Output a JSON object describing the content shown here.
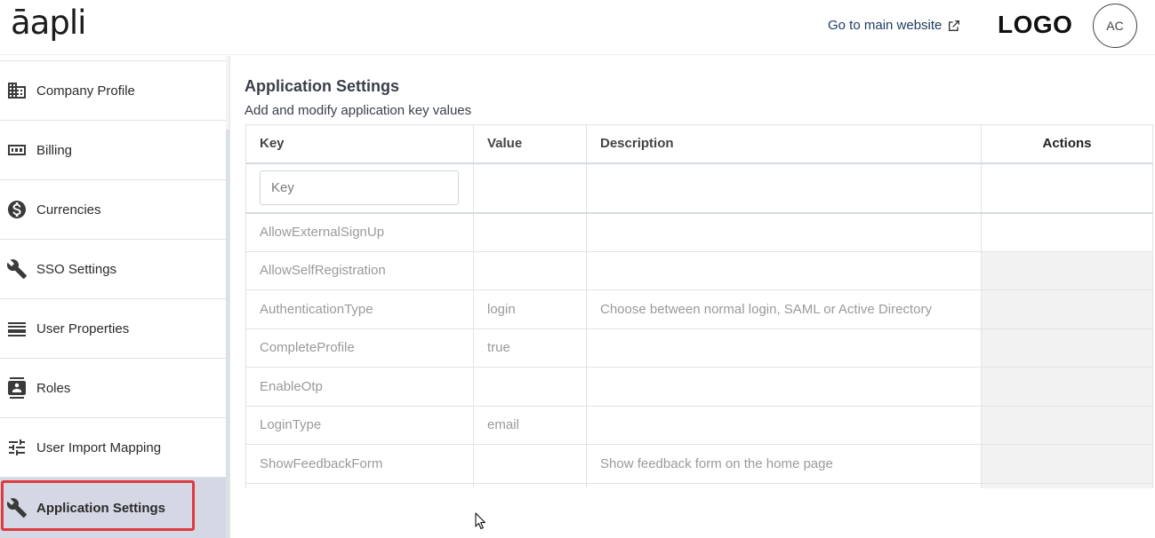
{
  "header": {
    "brand": "āapli",
    "main_link": "Go to main website",
    "logo": "LOGO",
    "avatar_initials": "AC"
  },
  "sidebar": {
    "items": [
      {
        "label": "Company Profile",
        "icon": "building-icon"
      },
      {
        "label": "Billing",
        "icon": "counter-icon"
      },
      {
        "label": "Currencies",
        "icon": "dollar-circle-icon"
      },
      {
        "label": "SSO Settings",
        "icon": "wrench-icon"
      },
      {
        "label": "User Properties",
        "icon": "list-icon"
      },
      {
        "label": "Roles",
        "icon": "contact-card-icon"
      },
      {
        "label": "User Import Mapping",
        "icon": "tune-sliders-icon"
      },
      {
        "label": "Application Settings",
        "icon": "wrench-icon",
        "active": true
      }
    ]
  },
  "main": {
    "title": "Application Settings",
    "subtitle": "Add and modify application key values",
    "table": {
      "columns": [
        "Key",
        "Value",
        "Description",
        "Actions"
      ],
      "filter_placeholder": "Key",
      "rows": [
        {
          "key": "AllowExternalSignUp",
          "value": "",
          "description": ""
        },
        {
          "key": "AllowSelfRegistration",
          "value": "",
          "description": ""
        },
        {
          "key": "AuthenticationType",
          "value": "login",
          "description": "Choose between normal login, SAML or Active Directory"
        },
        {
          "key": "CompleteProfile",
          "value": "true",
          "description": ""
        },
        {
          "key": "EnableOtp",
          "value": "",
          "description": ""
        },
        {
          "key": "LoginType",
          "value": "email",
          "description": ""
        },
        {
          "key": "ShowFeedbackForm",
          "value": "",
          "description": "Show feedback form on the home page"
        },
        {
          "key": "",
          "value": "",
          "description": ""
        }
      ]
    }
  },
  "colors": {
    "active_bg": "#d3d8e4",
    "highlight_border": "#e03a3e",
    "link": "#1e3a5f"
  }
}
